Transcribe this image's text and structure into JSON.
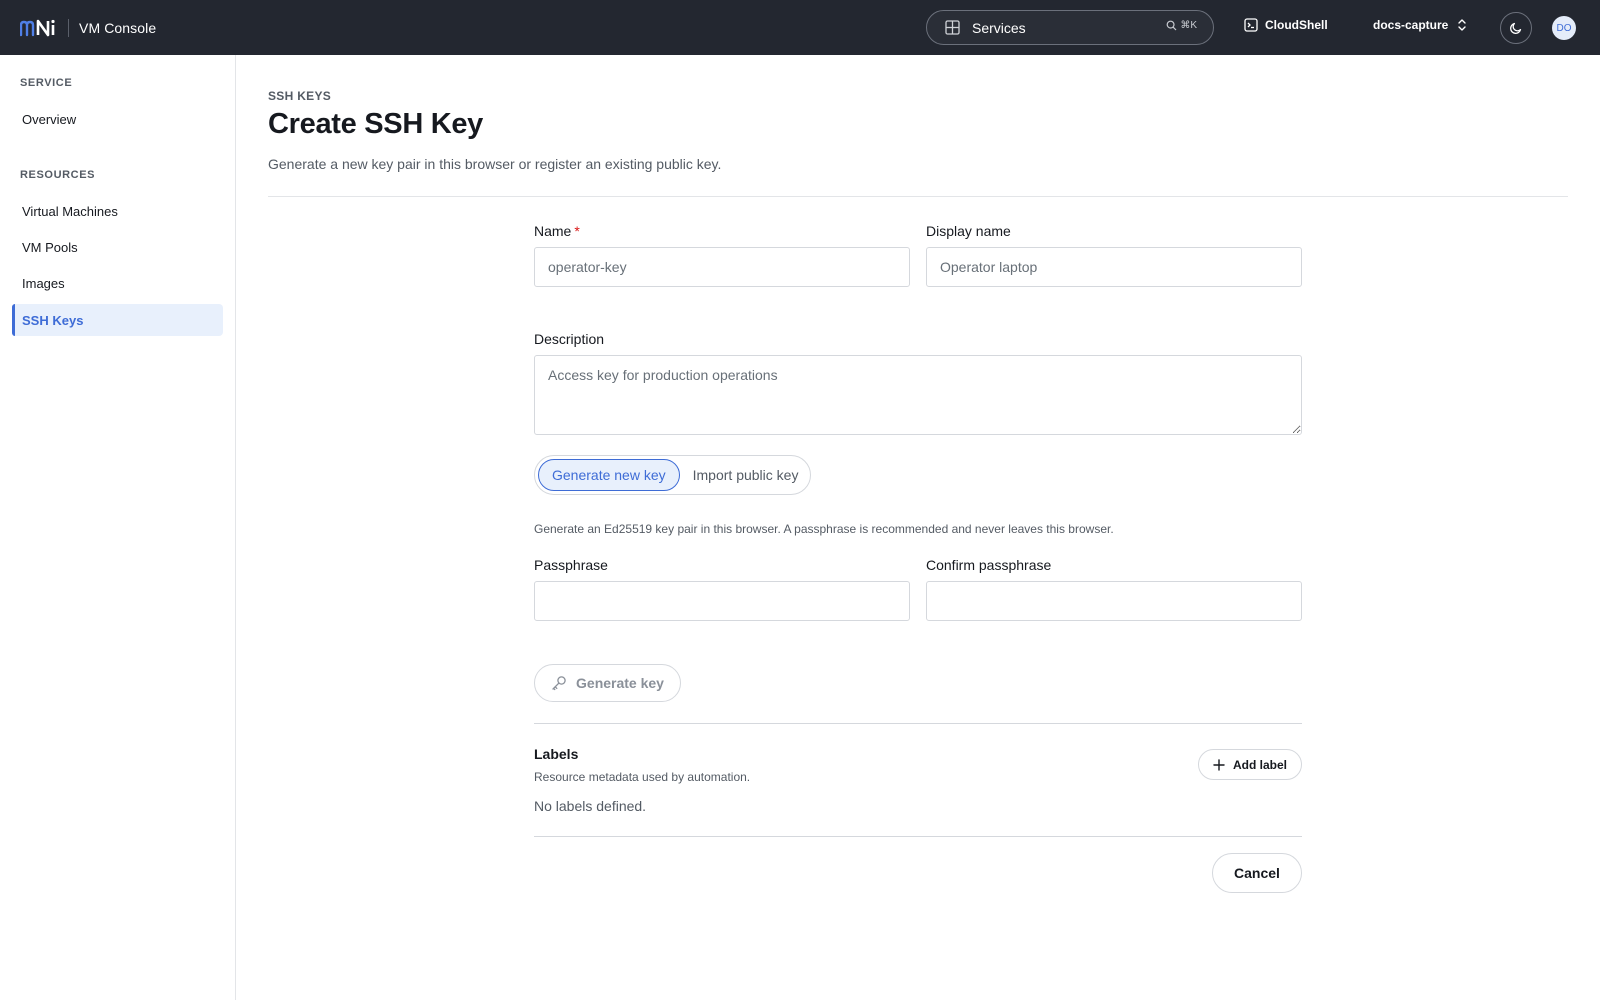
{
  "app": {
    "title": "VM Console",
    "search_label": "Services",
    "search_shortcut": "⌘K",
    "cloudshell_label": "CloudShell",
    "project_name": "docs-capture",
    "avatar_initials": "DO"
  },
  "sidebar": {
    "section_service": "SERVICE",
    "section_resources": "RESOURCES",
    "items": [
      {
        "label": "Overview"
      },
      {
        "label": "Virtual Machines"
      },
      {
        "label": "VM Pools"
      },
      {
        "label": "Images"
      },
      {
        "label": "SSH Keys",
        "active": true
      }
    ]
  },
  "page": {
    "eyebrow": "SSH KEYS",
    "title": "Create SSH Key",
    "subtitle": "Generate a new key pair in this browser or register an existing public key."
  },
  "form": {
    "name_label": "Name",
    "name_required": "*",
    "name_placeholder": "operator-key",
    "display_name_label": "Display name",
    "display_name_placeholder": "Operator laptop",
    "description_label": "Description",
    "description_placeholder": "Access key for production operations",
    "mode_options": [
      "Generate new key",
      "Import public key"
    ],
    "mode_selected": "Generate new key",
    "help_text": "Generate an Ed25519 key pair in this browser. A passphrase is recommended and never leaves this browser.",
    "passphrase_label": "Passphrase",
    "confirm_passphrase_label": "Confirm passphrase",
    "generate_button": "Generate key"
  },
  "labels": {
    "title": "Labels",
    "description": "Resource metadata used by automation.",
    "empty_text": "No labels defined.",
    "add_button": "Add label"
  },
  "footer": {
    "cancel_button": "Cancel"
  },
  "colors": {
    "topbar_bg": "#232730",
    "accent": "#3e6cd6",
    "required": "#d91515"
  }
}
